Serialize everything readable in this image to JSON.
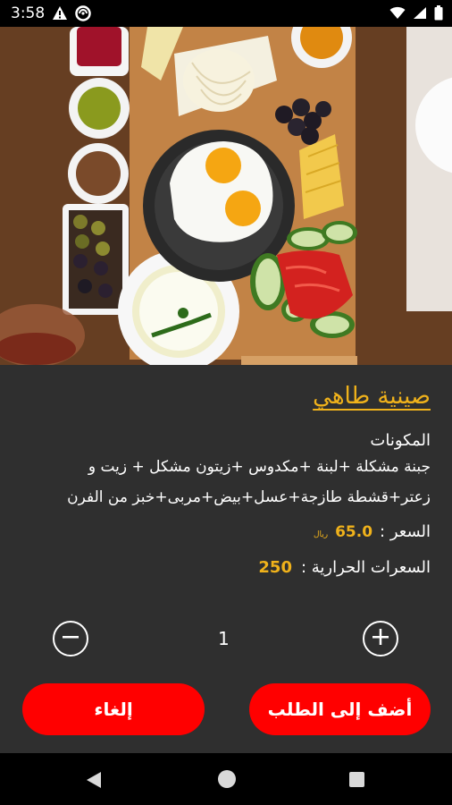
{
  "status_bar": {
    "time": "3:58",
    "icons_left": [
      "warning-icon",
      "sync-icon"
    ],
    "icons_right": [
      "wifi-icon",
      "signal-icon",
      "battery-icon"
    ]
  },
  "hero": {
    "icon": "breakfast-tray-photo"
  },
  "dish": {
    "title": "صينية طاهي",
    "ingredients_label": "المكونات",
    "ingredients_line1": "جبنة مشكلة +لبنة +مكدوس +زيتون مشكل + زيت و",
    "ingredients_line2": "زعتر+قشطة طازجة+عسل+بيض+مربى+خبز من الفرن",
    "price_label": "السعر :",
    "price_value": "65.0",
    "price_currency": "ريال",
    "calories_label": "السعرات الحرارية :",
    "calories_value": "250"
  },
  "quantity": {
    "value": "1",
    "minus_icon": "minus-circle-icon",
    "plus_icon": "plus-circle-icon"
  },
  "actions": {
    "cancel_label": "إلغاء",
    "add_label": "أضف إلى الطلب"
  },
  "colors": {
    "accent": "#f0b21b",
    "button": "#ff0000",
    "panel": "#2f2f2f"
  }
}
